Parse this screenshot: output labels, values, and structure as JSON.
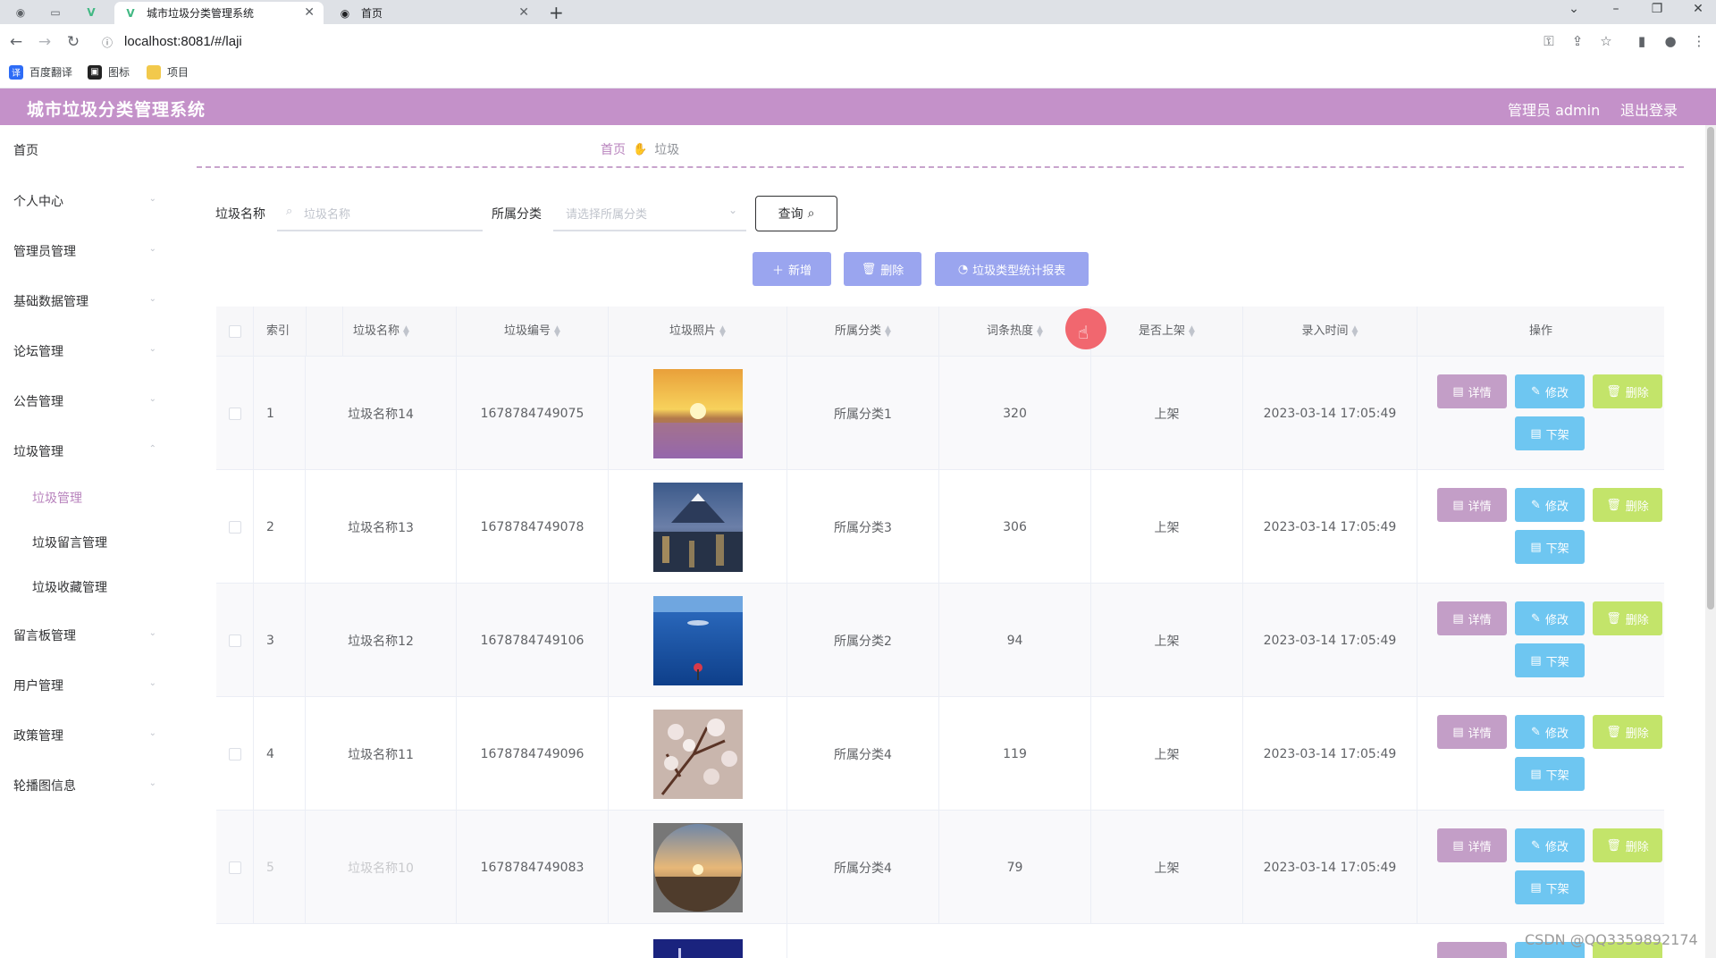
{
  "browser": {
    "tabs": [
      {
        "title": "城市垃圾分类管理系统",
        "active": true
      },
      {
        "title": "首页",
        "active": false
      }
    ],
    "url": "localhost:8081/#/laji",
    "bookmarks": [
      "百度翻译",
      "图标",
      "项目"
    ]
  },
  "header": {
    "title": "城市垃圾分类管理系统",
    "admin": "管理员 admin",
    "logout": "退出登录"
  },
  "sidebar": {
    "items": [
      {
        "label": "首页"
      },
      {
        "label": "个人中心"
      },
      {
        "label": "管理员管理"
      },
      {
        "label": "基础数据管理"
      },
      {
        "label": "论坛管理"
      },
      {
        "label": "公告管理"
      },
      {
        "label": "垃圾管理"
      },
      {
        "label": "留言板管理"
      },
      {
        "label": "用户管理"
      },
      {
        "label": "政策管理"
      },
      {
        "label": "轮播图信息"
      }
    ],
    "sub_items": [
      {
        "label": "垃圾管理",
        "active": true
      },
      {
        "label": "垃圾留言管理",
        "active": false
      },
      {
        "label": "垃圾收藏管理",
        "active": false
      }
    ]
  },
  "breadcrumb": {
    "home": "首页",
    "current": "垃圾"
  },
  "search": {
    "name_label": "垃圾名称",
    "name_placeholder": "垃圾名称",
    "category_label": "所属分类",
    "category_placeholder": "请选择所属分类",
    "query_button": "查询"
  },
  "actions": {
    "add": "新增",
    "delete": "删除",
    "report": "垃圾类型统计报表"
  },
  "table": {
    "columns": [
      "索引",
      "垃圾名称",
      "垃圾编号",
      "垃圾照片",
      "所属分类",
      "词条热度",
      "是否上架",
      "录入时间",
      "操作"
    ],
    "row_buttons": {
      "detail": "详情",
      "edit": "修改",
      "delete": "删除",
      "offshelf": "下架"
    },
    "rows": [
      {
        "index": "1",
        "name": "垃圾名称14",
        "code": "1678784749075",
        "photo": "sunset-flower-field",
        "category": "所属分类1",
        "heat": "320",
        "shelf": "上架",
        "time": "2023-03-14 17:05:49"
      },
      {
        "index": "2",
        "name": "垃圾名称13",
        "code": "1678784749078",
        "photo": "mountain-city-night",
        "category": "所属分类3",
        "heat": "306",
        "shelf": "上架",
        "time": "2023-03-14 17:05:49"
      },
      {
        "index": "3",
        "name": "垃圾名称12",
        "code": "1678784749106",
        "photo": "blue-sea-girl",
        "category": "所属分类2",
        "heat": "94",
        "shelf": "上架",
        "time": "2023-03-14 17:05:49"
      },
      {
        "index": "4",
        "name": "垃圾名称11",
        "code": "1678784749096",
        "photo": "cherry-blossom",
        "category": "所属分类4",
        "heat": "119",
        "shelf": "上架",
        "time": "2023-03-14 17:05:49"
      },
      {
        "index": "5",
        "name": "垃圾名称10",
        "code": "1678784749083",
        "photo": "round-sunset",
        "category": "所属分类4",
        "heat": "79",
        "shelf": "上架",
        "time": "2023-03-14 17:05:49"
      }
    ]
  },
  "watermark": "CSDN @QQ3359892174",
  "colors": {
    "header": "#c491c9",
    "accent": "#b883bd",
    "primary_button": "#9aa5ef",
    "detail": "#c39ec7",
    "edit": "#6ec6f1",
    "delete": "#c3e46a"
  }
}
